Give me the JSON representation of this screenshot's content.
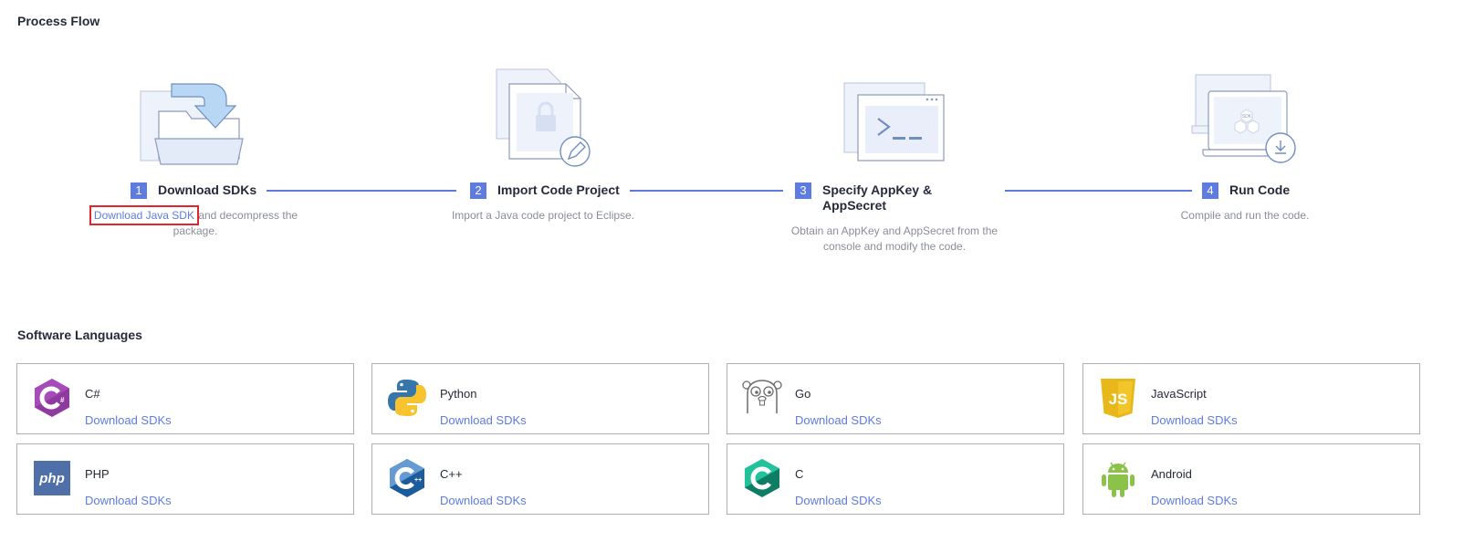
{
  "process_flow": {
    "title": "Process Flow",
    "steps": [
      {
        "number": "1",
        "label": "Download SDKs",
        "link_text": "Download Java SDK",
        "desc_rest": " and decompress the package."
      },
      {
        "number": "2",
        "label": "Import Code Project",
        "desc": "Import a Java code project to Eclipse."
      },
      {
        "number": "3",
        "label": "Specify AppKey & AppSecret",
        "desc": "Obtain an AppKey and AppSecret from the console and modify the code."
      },
      {
        "number": "4",
        "label": "Run Code",
        "desc": "Compile and run the code."
      }
    ],
    "icon_text": {
      "sdk_badge": "SDK"
    }
  },
  "software_languages": {
    "title": "Software Languages",
    "download_label": "Download SDKs",
    "languages": [
      {
        "name": "C#",
        "icon": "csharp-icon",
        "color": "#8e3a9e"
      },
      {
        "name": "Python",
        "icon": "python-icon",
        "color": "#3776ab"
      },
      {
        "name": "Go",
        "icon": "go-gopher-icon",
        "color": "#6b6b6b"
      },
      {
        "name": "JavaScript",
        "icon": "javascript-icon",
        "color": "#e8b71a"
      },
      {
        "name": "PHP",
        "icon": "php-icon",
        "color": "#4f6fa8"
      },
      {
        "name": "C++",
        "icon": "cplusplus-icon",
        "color": "#1d5c9c"
      },
      {
        "name": "C",
        "icon": "c-icon",
        "color": "#13a37f"
      },
      {
        "name": "Android",
        "icon": "android-icon",
        "color": "#8bc34a"
      }
    ]
  },
  "colors": {
    "accent": "#5e7ce0",
    "highlight_border": "#e3262e",
    "text": "#252b3a",
    "muted_text": "#8a8e99"
  }
}
